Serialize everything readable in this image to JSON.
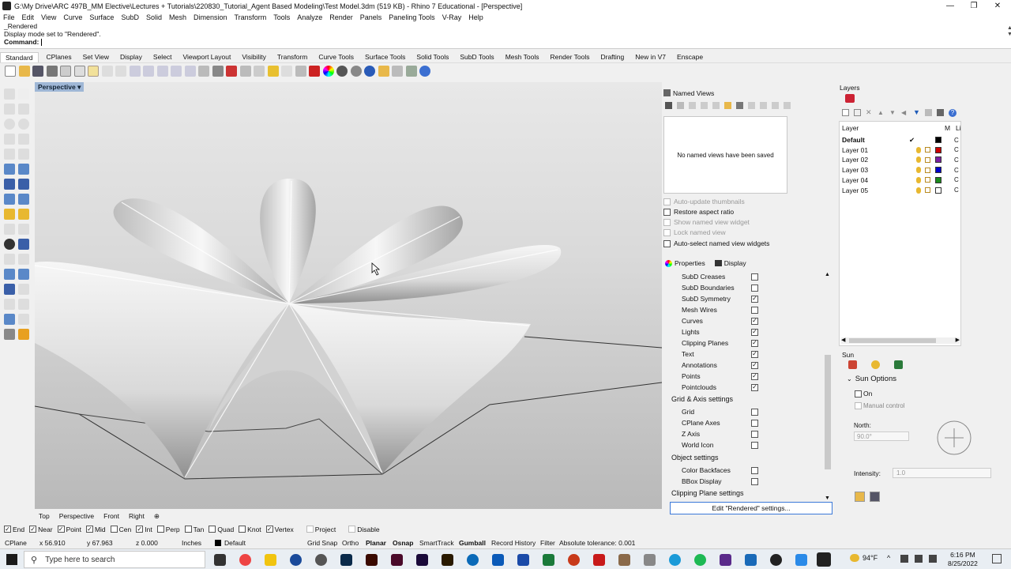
{
  "window": {
    "title": "G:\\My Drive\\ARC 497B_MM Elective\\Lectures + Tutorials\\220830_Tutorial_Agent Based Modeling\\Test Model.3dm (519 KB) - Rhino 7 Educational - [Perspective]",
    "minimize": "—",
    "maximize": "❐",
    "close": "✕"
  },
  "menu": [
    "File",
    "Edit",
    "View",
    "Curve",
    "Surface",
    "SubD",
    "Solid",
    "Mesh",
    "Dimension",
    "Transform",
    "Tools",
    "Analyze",
    "Render",
    "Panels",
    "Paneling Tools",
    "V-Ray",
    "Help"
  ],
  "history": {
    "line1": "_Rendered",
    "line2": "Display mode set to \"Rendered\".",
    "prompt": "Command:"
  },
  "toolbar_tabs": [
    "Standard",
    "CPlanes",
    "Set View",
    "Display",
    "Select",
    "Viewport Layout",
    "Visibility",
    "Transform",
    "Curve Tools",
    "Surface Tools",
    "Solid Tools",
    "SubD Tools",
    "Mesh Tools",
    "Render Tools",
    "Drafting",
    "New in V7",
    "Enscape"
  ],
  "viewport": {
    "label": "Perspective",
    "tabs": [
      "Top",
      "Perspective",
      "Front",
      "Right",
      "⊕"
    ]
  },
  "osnap": [
    {
      "label": "End",
      "checked": true
    },
    {
      "label": "Near",
      "checked": true
    },
    {
      "label": "Point",
      "checked": true
    },
    {
      "label": "Mid",
      "checked": true
    },
    {
      "label": "Cen",
      "checked": false
    },
    {
      "label": "Int",
      "checked": true
    },
    {
      "label": "Perp",
      "checked": false
    },
    {
      "label": "Tan",
      "checked": false
    },
    {
      "label": "Quad",
      "checked": false
    },
    {
      "label": "Knot",
      "checked": false
    },
    {
      "label": "Vertex",
      "checked": true
    },
    {
      "label": "Project",
      "checked": false
    },
    {
      "label": "Disable",
      "checked": false
    }
  ],
  "status": {
    "cplane": "CPlane",
    "x": "x 56.910",
    "y": "y 67.963",
    "z": "z 0.000",
    "units": "Inches",
    "layer": "Default",
    "grid_snap": "Grid Snap",
    "ortho": "Ortho",
    "planar": "Planar",
    "osnap": "Osnap",
    "smarttrack": "SmartTrack",
    "gumball": "Gumball",
    "record_history": "Record History",
    "filter": "Filter",
    "tolerance": "Absolute tolerance: 0.001"
  },
  "named_views": {
    "title": "Named Views",
    "empty_message": "No named views have been saved",
    "options": [
      {
        "label": "Auto-update thumbnails",
        "enabled": false
      },
      {
        "label": "Restore aspect ratio",
        "enabled": true
      },
      {
        "label": "Show named view widget",
        "enabled": false
      },
      {
        "label": "Lock named view",
        "enabled": false
      },
      {
        "label": "Auto-select named view widgets",
        "enabled": true
      }
    ]
  },
  "properties": {
    "tab1": "Properties",
    "tab2": "Display",
    "rows": [
      {
        "label": "SubD Creases",
        "checked": false
      },
      {
        "label": "SubD Boundaries",
        "checked": false
      },
      {
        "label": "SubD Symmetry",
        "checked": true
      },
      {
        "label": "Mesh Wires",
        "checked": false
      },
      {
        "label": "Curves",
        "checked": true
      },
      {
        "label": "Lights",
        "checked": true
      },
      {
        "label": "Clipping Planes",
        "checked": true
      },
      {
        "label": "Text",
        "checked": true
      },
      {
        "label": "Annotations",
        "checked": true
      },
      {
        "label": "Points",
        "checked": true
      },
      {
        "label": "Pointclouds",
        "checked": true
      }
    ],
    "section_grid": "Grid & Axis settings",
    "grid_rows": [
      {
        "label": "Grid",
        "checked": false
      },
      {
        "label": "CPlane Axes",
        "checked": false
      },
      {
        "label": "Z Axis",
        "checked": false
      },
      {
        "label": "World Icon",
        "checked": false
      }
    ],
    "section_object": "Object settings",
    "object_rows": [
      {
        "label": "Color Backfaces",
        "checked": false
      },
      {
        "label": "BBox Display",
        "checked": false
      }
    ],
    "section_clipping": "Clipping Plane settings",
    "edit_button": "Edit \"Rendered\" settings..."
  },
  "layers": {
    "title": "Layers",
    "col_layer": "Layer",
    "col_m": "M",
    "col_l": "Li",
    "rows": [
      {
        "name": "Default",
        "color": "#000000",
        "bold": true,
        "current": "✔",
        "mat": "C"
      },
      {
        "name": "Layer 01",
        "color": "#cc0000",
        "bold": false,
        "current": "",
        "mat": "C"
      },
      {
        "name": "Layer 02",
        "color": "#7b1fa2",
        "bold": false,
        "current": "",
        "mat": "C"
      },
      {
        "name": "Layer 03",
        "color": "#0000cc",
        "bold": false,
        "current": "",
        "mat": "C"
      },
      {
        "name": "Layer 04",
        "color": "#1b8a1b",
        "bold": false,
        "current": "",
        "mat": "C"
      },
      {
        "name": "Layer 05",
        "color": "#ffffff",
        "bold": false,
        "current": "",
        "mat": "C"
      }
    ]
  },
  "sun": {
    "title": "Sun",
    "options_header": "Sun Options",
    "on_label": "On",
    "manual_label": "Manual control",
    "north_label": "North:",
    "north_value": "90.0°",
    "intensity_label": "Intensity:",
    "intensity_value": "1.0"
  },
  "taskbar": {
    "search_placeholder": "Type here to search",
    "weather": "94°F",
    "time": "6:16 PM",
    "date": "8/25/2022"
  }
}
